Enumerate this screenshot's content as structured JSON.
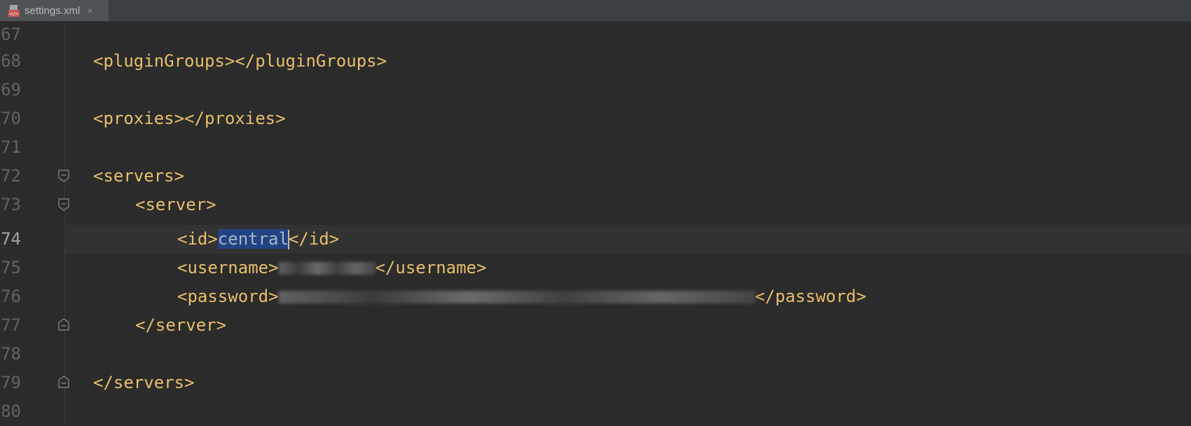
{
  "tab": {
    "filename": "settings.xml",
    "close_symbol": "×",
    "icon": "xml-file-icon"
  },
  "editor": {
    "current_line": "74",
    "lines": [
      {
        "number": "67"
      },
      {
        "number": "68",
        "open": "<pluginGroups>",
        "close": "</pluginGroups>"
      },
      {
        "number": "69"
      },
      {
        "number": "70",
        "open": "<proxies>",
        "close": "</proxies>"
      },
      {
        "number": "71"
      },
      {
        "number": "72",
        "open": "<servers>"
      },
      {
        "number": "73",
        "open": "<server>"
      },
      {
        "number": "74",
        "open": "<id>",
        "value": "central",
        "close": "</id>"
      },
      {
        "number": "75",
        "open": "<username>",
        "value_visible": "7 1 9 1",
        "close": "</username>"
      },
      {
        "number": "76",
        "open": "<password>",
        "value_visible": "NZXoPOOjadcXt4oV",
        "close": "</password>"
      },
      {
        "number": "77",
        "close": "</server>"
      },
      {
        "number": "78"
      },
      {
        "number": "79",
        "close": "</servers>"
      },
      {
        "number": "80"
      }
    ]
  },
  "colors": {
    "background": "#2b2b2b",
    "tag": "#e8bf6a",
    "text": "#a9b7c6",
    "selection": "#214283",
    "line_number": "#606366",
    "current_line": "#323232"
  }
}
